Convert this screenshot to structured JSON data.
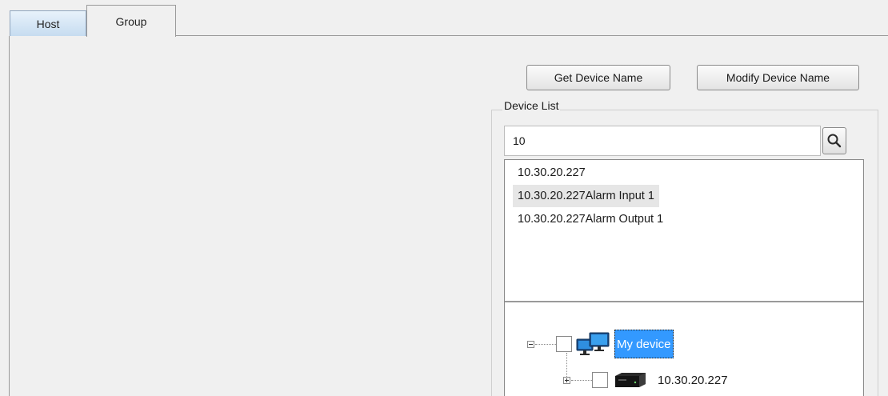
{
  "tabs": [
    {
      "label": "Host",
      "selected": false
    },
    {
      "label": "Group",
      "selected": true
    }
  ],
  "toolbar": {
    "get_device_name_label": "Get Device Name",
    "modify_device_name_label": "Modify Device Name"
  },
  "device_list": {
    "title": "Device List",
    "search": {
      "value": "10",
      "placeholder": "",
      "icon": "search-icon"
    },
    "results": [
      "10.30.20.227",
      "10.30.20.227Alarm Input 1",
      "10.30.20.227Alarm Output 1"
    ],
    "highlighted_result_index": 1,
    "tree": {
      "root": {
        "label": "My device",
        "expanded": true,
        "checked": false,
        "selected": true,
        "icon": "monitors-icon"
      },
      "children": [
        {
          "label": "10.30.20.227",
          "expanded": false,
          "checked": false,
          "icon": "dvr-device-icon"
        }
      ]
    }
  },
  "colors": {
    "background": "#f0f0f0",
    "selection": "#3399ff",
    "tab_active_gradient_top": "#e8f2fb",
    "tab_active_gradient_bottom": "#c6dcf0"
  }
}
